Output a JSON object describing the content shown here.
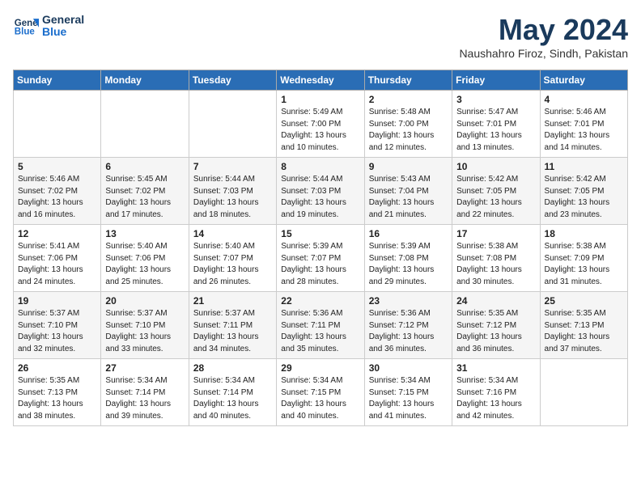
{
  "header": {
    "logo_line1": "General",
    "logo_line2": "Blue",
    "month_year": "May 2024",
    "location": "Naushahro Firoz, Sindh, Pakistan"
  },
  "days_of_week": [
    "Sunday",
    "Monday",
    "Tuesday",
    "Wednesday",
    "Thursday",
    "Friday",
    "Saturday"
  ],
  "weeks": [
    [
      {
        "day": "",
        "info": ""
      },
      {
        "day": "",
        "info": ""
      },
      {
        "day": "",
        "info": ""
      },
      {
        "day": "1",
        "info": "Sunrise: 5:49 AM\nSunset: 7:00 PM\nDaylight: 13 hours\nand 10 minutes."
      },
      {
        "day": "2",
        "info": "Sunrise: 5:48 AM\nSunset: 7:00 PM\nDaylight: 13 hours\nand 12 minutes."
      },
      {
        "day": "3",
        "info": "Sunrise: 5:47 AM\nSunset: 7:01 PM\nDaylight: 13 hours\nand 13 minutes."
      },
      {
        "day": "4",
        "info": "Sunrise: 5:46 AM\nSunset: 7:01 PM\nDaylight: 13 hours\nand 14 minutes."
      }
    ],
    [
      {
        "day": "5",
        "info": "Sunrise: 5:46 AM\nSunset: 7:02 PM\nDaylight: 13 hours\nand 16 minutes."
      },
      {
        "day": "6",
        "info": "Sunrise: 5:45 AM\nSunset: 7:02 PM\nDaylight: 13 hours\nand 17 minutes."
      },
      {
        "day": "7",
        "info": "Sunrise: 5:44 AM\nSunset: 7:03 PM\nDaylight: 13 hours\nand 18 minutes."
      },
      {
        "day": "8",
        "info": "Sunrise: 5:44 AM\nSunset: 7:03 PM\nDaylight: 13 hours\nand 19 minutes."
      },
      {
        "day": "9",
        "info": "Sunrise: 5:43 AM\nSunset: 7:04 PM\nDaylight: 13 hours\nand 21 minutes."
      },
      {
        "day": "10",
        "info": "Sunrise: 5:42 AM\nSunset: 7:05 PM\nDaylight: 13 hours\nand 22 minutes."
      },
      {
        "day": "11",
        "info": "Sunrise: 5:42 AM\nSunset: 7:05 PM\nDaylight: 13 hours\nand 23 minutes."
      }
    ],
    [
      {
        "day": "12",
        "info": "Sunrise: 5:41 AM\nSunset: 7:06 PM\nDaylight: 13 hours\nand 24 minutes."
      },
      {
        "day": "13",
        "info": "Sunrise: 5:40 AM\nSunset: 7:06 PM\nDaylight: 13 hours\nand 25 minutes."
      },
      {
        "day": "14",
        "info": "Sunrise: 5:40 AM\nSunset: 7:07 PM\nDaylight: 13 hours\nand 26 minutes."
      },
      {
        "day": "15",
        "info": "Sunrise: 5:39 AM\nSunset: 7:07 PM\nDaylight: 13 hours\nand 28 minutes."
      },
      {
        "day": "16",
        "info": "Sunrise: 5:39 AM\nSunset: 7:08 PM\nDaylight: 13 hours\nand 29 minutes."
      },
      {
        "day": "17",
        "info": "Sunrise: 5:38 AM\nSunset: 7:08 PM\nDaylight: 13 hours\nand 30 minutes."
      },
      {
        "day": "18",
        "info": "Sunrise: 5:38 AM\nSunset: 7:09 PM\nDaylight: 13 hours\nand 31 minutes."
      }
    ],
    [
      {
        "day": "19",
        "info": "Sunrise: 5:37 AM\nSunset: 7:10 PM\nDaylight: 13 hours\nand 32 minutes."
      },
      {
        "day": "20",
        "info": "Sunrise: 5:37 AM\nSunset: 7:10 PM\nDaylight: 13 hours\nand 33 minutes."
      },
      {
        "day": "21",
        "info": "Sunrise: 5:37 AM\nSunset: 7:11 PM\nDaylight: 13 hours\nand 34 minutes."
      },
      {
        "day": "22",
        "info": "Sunrise: 5:36 AM\nSunset: 7:11 PM\nDaylight: 13 hours\nand 35 minutes."
      },
      {
        "day": "23",
        "info": "Sunrise: 5:36 AM\nSunset: 7:12 PM\nDaylight: 13 hours\nand 36 minutes."
      },
      {
        "day": "24",
        "info": "Sunrise: 5:35 AM\nSunset: 7:12 PM\nDaylight: 13 hours\nand 36 minutes."
      },
      {
        "day": "25",
        "info": "Sunrise: 5:35 AM\nSunset: 7:13 PM\nDaylight: 13 hours\nand 37 minutes."
      }
    ],
    [
      {
        "day": "26",
        "info": "Sunrise: 5:35 AM\nSunset: 7:13 PM\nDaylight: 13 hours\nand 38 minutes."
      },
      {
        "day": "27",
        "info": "Sunrise: 5:34 AM\nSunset: 7:14 PM\nDaylight: 13 hours\nand 39 minutes."
      },
      {
        "day": "28",
        "info": "Sunrise: 5:34 AM\nSunset: 7:14 PM\nDaylight: 13 hours\nand 40 minutes."
      },
      {
        "day": "29",
        "info": "Sunrise: 5:34 AM\nSunset: 7:15 PM\nDaylight: 13 hours\nand 40 minutes."
      },
      {
        "day": "30",
        "info": "Sunrise: 5:34 AM\nSunset: 7:15 PM\nDaylight: 13 hours\nand 41 minutes."
      },
      {
        "day": "31",
        "info": "Sunrise: 5:34 AM\nSunset: 7:16 PM\nDaylight: 13 hours\nand 42 minutes."
      },
      {
        "day": "",
        "info": ""
      }
    ]
  ]
}
